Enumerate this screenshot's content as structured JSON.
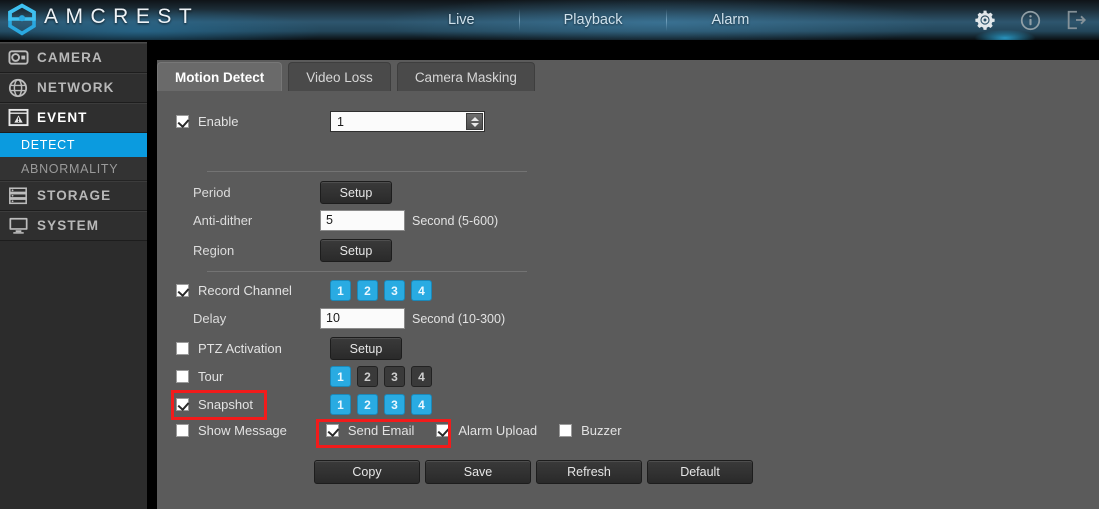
{
  "header": {
    "brand": "AMCREST",
    "logo_icon": "amcrest-hexagon-logo",
    "nav": [
      {
        "label": "Live"
      },
      {
        "label": "Playback"
      },
      {
        "label": "Alarm"
      }
    ],
    "icons": [
      {
        "name": "gear-icon",
        "title": "Settings"
      },
      {
        "name": "info-icon",
        "title": "Info"
      },
      {
        "name": "logout-icon",
        "title": "Logout"
      }
    ]
  },
  "sidebar": {
    "items": [
      {
        "label": "CAMERA",
        "icon": "camera-dome-icon",
        "active": false
      },
      {
        "label": "NETWORK",
        "icon": "network-globe-icon",
        "active": false
      },
      {
        "label": "EVENT",
        "icon": "event-warning-icon",
        "active": true
      },
      {
        "label": "STORAGE",
        "icon": "storage-rack-icon",
        "active": false
      },
      {
        "label": "SYSTEM",
        "icon": "system-monitor-icon",
        "active": false
      }
    ],
    "sub_items": [
      {
        "label": "DETECT",
        "selected": true
      },
      {
        "label": "ABNORMALITY",
        "selected": false
      }
    ]
  },
  "content": {
    "tabs": [
      {
        "label": "Motion Detect",
        "active": true
      },
      {
        "label": "Video Loss",
        "active": false
      },
      {
        "label": "Camera Masking",
        "active": false
      }
    ],
    "enable": {
      "label": "Enable",
      "checked": true,
      "channel_value": "1"
    },
    "period": {
      "label": "Period",
      "button": "Setup"
    },
    "anti_dither": {
      "label": "Anti-dither",
      "value": "5",
      "unit": "Second (5-600)"
    },
    "region": {
      "label": "Region",
      "button": "Setup"
    },
    "record_channel": {
      "label": "Record Channel",
      "checked": true,
      "channels": [
        {
          "label": "1",
          "on": true
        },
        {
          "label": "2",
          "on": true
        },
        {
          "label": "3",
          "on": true
        },
        {
          "label": "4",
          "on": true
        }
      ]
    },
    "delay": {
      "label": "Delay",
      "value": "10",
      "unit": "Second (10-300)"
    },
    "ptz_activation": {
      "label": "PTZ Activation",
      "checked": false,
      "button": "Setup"
    },
    "tour": {
      "label": "Tour",
      "checked": false,
      "channels": [
        {
          "label": "1",
          "on": true
        },
        {
          "label": "2",
          "on": false
        },
        {
          "label": "3",
          "on": false
        },
        {
          "label": "4",
          "on": false
        }
      ]
    },
    "snapshot": {
      "label": "Snapshot",
      "checked": true,
      "highlighted": true,
      "channels": [
        {
          "label": "1",
          "on": true
        },
        {
          "label": "2",
          "on": true
        },
        {
          "label": "3",
          "on": true
        },
        {
          "label": "4",
          "on": true
        }
      ]
    },
    "alarm_outputs": [
      {
        "label": "Show Message",
        "checked": false,
        "highlighted": false
      },
      {
        "label": "Send Email",
        "checked": true,
        "highlighted": true
      },
      {
        "label": "Alarm Upload",
        "checked": true,
        "highlighted": false
      },
      {
        "label": "Buzzer",
        "checked": false,
        "highlighted": false
      }
    ],
    "actions": [
      {
        "label": "Copy"
      },
      {
        "label": "Save"
      },
      {
        "label": "Refresh"
      },
      {
        "label": "Default"
      }
    ]
  },
  "colors": {
    "accent_blue": "#29abe2",
    "sidebar_selected": "#0b9bdf",
    "highlight_red": "#f21b1b",
    "panel_gray": "#5b5b5b"
  }
}
